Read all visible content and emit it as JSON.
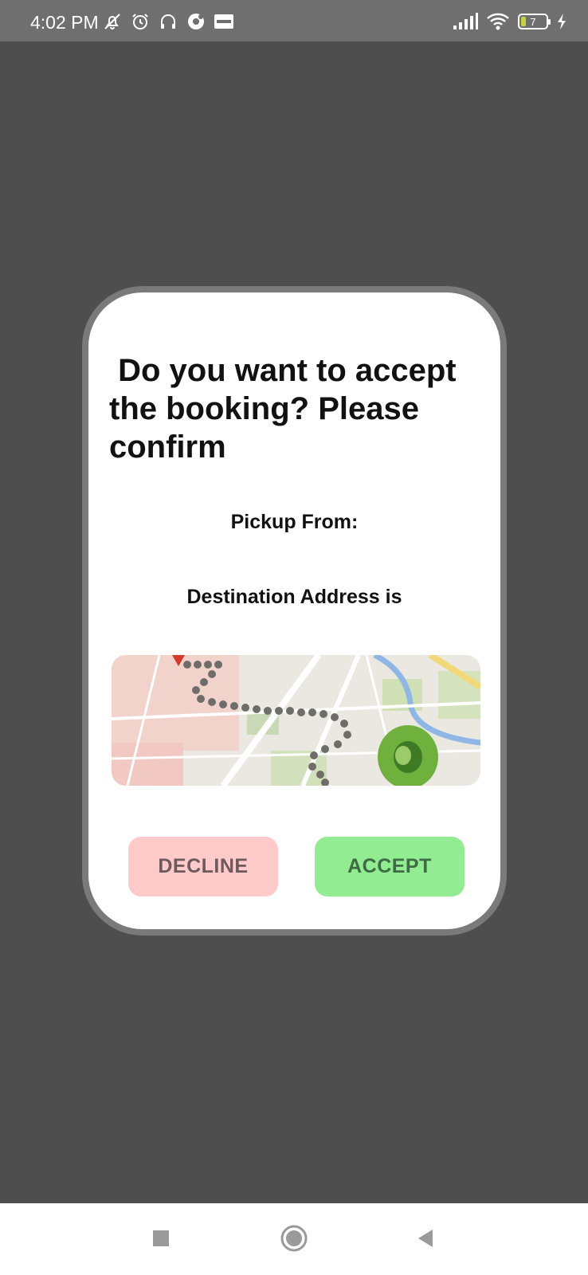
{
  "status_bar": {
    "time": "4:02 PM",
    "left_icons": [
      "bell-off-icon",
      "alarm-icon",
      "headphones-icon",
      "app-notification-icon",
      "app-badge-icon"
    ],
    "right_icons": [
      "signal-icon",
      "wifi-icon",
      "battery-icon",
      "charging-icon"
    ],
    "battery_level": "7"
  },
  "dialog": {
    "title": " Do you want to accept the booking? Please confirm",
    "pickup_label": "Pickup From:",
    "destination_label": "Destination Address is",
    "map_image": "route-map-illustration",
    "decline_label": "DECLINE",
    "accept_label": "ACCEPT",
    "colors": {
      "decline_bg": "#ffcaca",
      "accept_bg": "#92ec91",
      "overlay": "#4e4e4e"
    }
  },
  "nav_bar": {
    "buttons": [
      "recents-icon",
      "home-icon",
      "back-icon"
    ]
  }
}
